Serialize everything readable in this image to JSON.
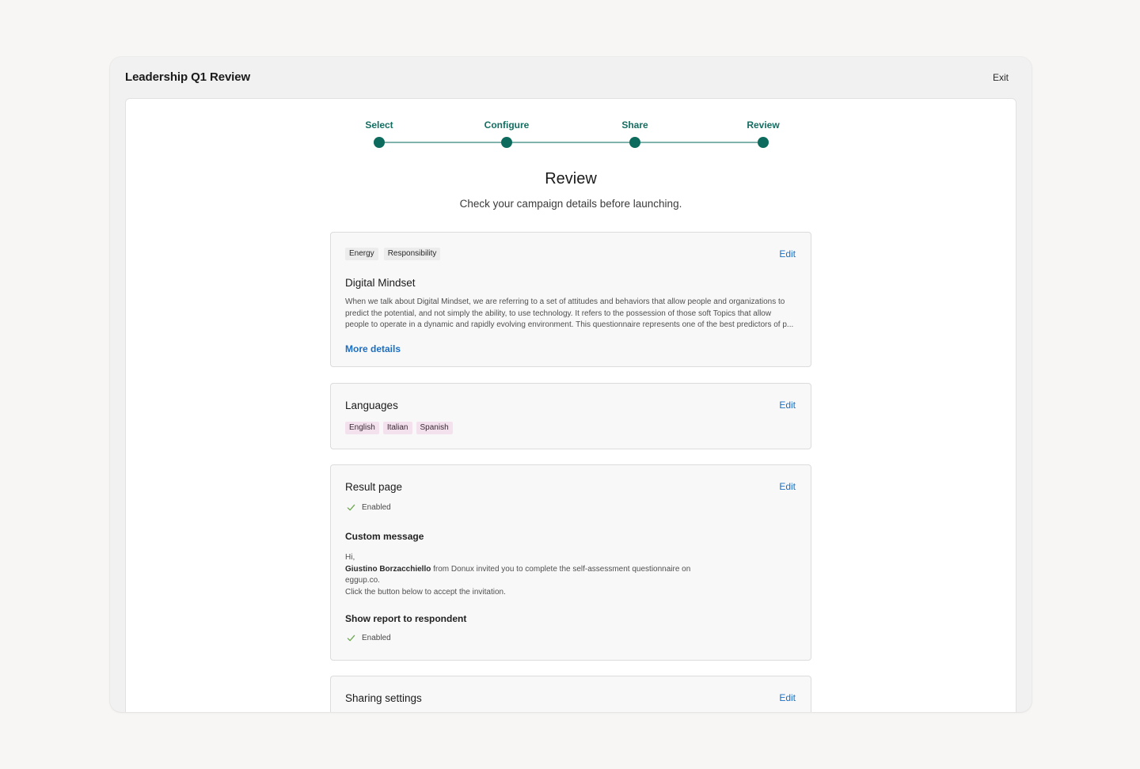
{
  "window": {
    "title": "Leadership Q1 Review",
    "exit_label": "Exit"
  },
  "stepper": {
    "steps": [
      {
        "label": "Select"
      },
      {
        "label": "Configure"
      },
      {
        "label": "Share"
      },
      {
        "label": "Review"
      }
    ],
    "current": "Review"
  },
  "page": {
    "heading": "Review",
    "subheading": "Check your campaign details before launching."
  },
  "questionnaire_card": {
    "tags": [
      "Energy",
      "Responsibility"
    ],
    "title": "Digital Mindset",
    "description_lines": [
      "When we talk about Digital Mindset, we are referring to a set of attitudes and behaviors that allow people and organizations to",
      "predict the potential, and not simply the ability, to use technology. It refers to the possession of those soft Topics that allow",
      "people to operate in a dynamic and rapidly evolving environment. This questionnaire represents one of the best predictors of p..."
    ],
    "more_label": "More details",
    "edit_label": "Edit"
  },
  "languages_card": {
    "title": "Languages",
    "tags": [
      "English",
      "Italian",
      "Spanish"
    ],
    "edit_label": "Edit"
  },
  "result_card": {
    "title": "Result page",
    "status": "Enabled",
    "custom_message_title": "Custom message",
    "message": {
      "greeting": "Hi,",
      "sender": "Giustino Borzacchiello",
      "line1_rest": " from Donux invited you to complete the self-assessment questionnaire on",
      "line2": "eggup.co.",
      "line3": "Click the button below to accept the invitation."
    },
    "show_report_title": "Show report  to respondent",
    "show_report_status": "Enabled",
    "edit_label": "Edit"
  },
  "sharing_card": {
    "title": "Sharing settings",
    "edit_label": "Edit"
  },
  "colors": {
    "accent": "#0d6b5e",
    "link": "#1a6fc4",
    "check": "#6aa84f",
    "language_tag_bg": "#f3e2ee"
  }
}
